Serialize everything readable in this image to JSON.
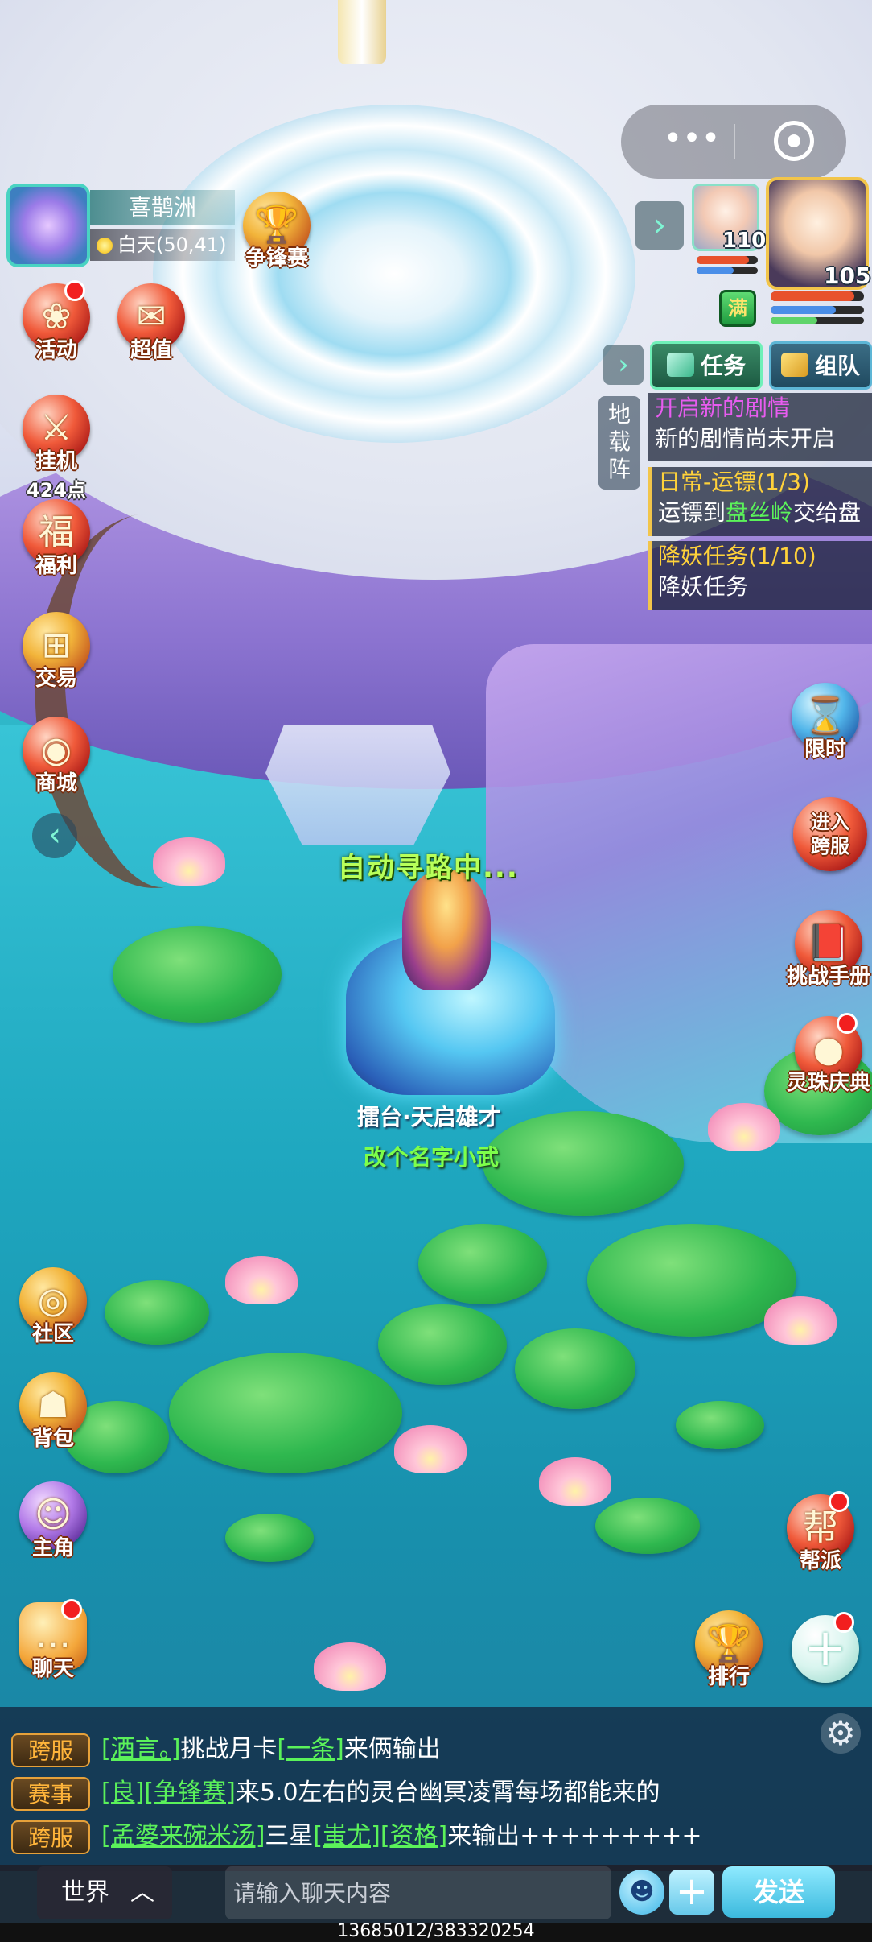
{
  "map": {
    "name": "喜鹊洲",
    "time_status": "白天(50,41)"
  },
  "top_icons": {
    "arena": "争锋赛",
    "activity": "活动",
    "recharge": "超值",
    "idle": "挂机",
    "idle_points": "424点",
    "welfare": "福利",
    "trade": "交易",
    "shop": "商城"
  },
  "team": {
    "pet_level": "110",
    "player_level": "105",
    "full_tag": "满",
    "pet_hp": 0.85,
    "pet_mp": 0.6,
    "player_hp": 0.9,
    "player_mp": 0.7,
    "player_exp": 0.5
  },
  "quest_tracker": {
    "tab_task": "任务",
    "tab_team": "组队",
    "formation": [
      "地",
      "载",
      "阵"
    ],
    "quests": [
      {
        "title": "开启新的剧情",
        "desc": "新的剧情尚未开启"
      },
      {
        "title": "日常-运镖(1/3)",
        "desc_pre": "运镖到",
        "desc_place": "盘丝岭",
        "desc_post": "交给盘"
      },
      {
        "title": "降妖任务(1/10)",
        "desc": "降妖任务"
      }
    ]
  },
  "right_icons": {
    "limited": "限时",
    "cross_server": "进入跨服",
    "challenge": "挑战手册",
    "pearl": "灵珠庆典",
    "guild": "帮派",
    "ranking": "排行"
  },
  "left_icons": {
    "community": "社区",
    "bag": "背包",
    "character": "主角",
    "chat": "聊天"
  },
  "scene": {
    "auto_path": "自动寻路中...",
    "hero_title": "擂台·天启雄才",
    "hero_name": "改个名字小武"
  },
  "chat": {
    "lines": [
      {
        "channel": "跨服",
        "parts": [
          "[酒言。]",
          "挑战月卡",
          "[一条]",
          "来俩输出"
        ]
      },
      {
        "channel": "赛事",
        "parts": [
          "[良]",
          "[争锋赛]",
          "来5.0左右的灵台幽冥凌霄每场都能来的"
        ]
      },
      {
        "channel": "跨服",
        "parts": [
          "[孟婆来碗米汤]",
          "三星",
          "[蚩尤]",
          "[资格]",
          "来输出+++++++++"
        ]
      }
    ],
    "channel_select": "世界",
    "input_placeholder": "请输入聊天内容",
    "send_label": "发送"
  },
  "coordinates": "13685012/383320254"
}
